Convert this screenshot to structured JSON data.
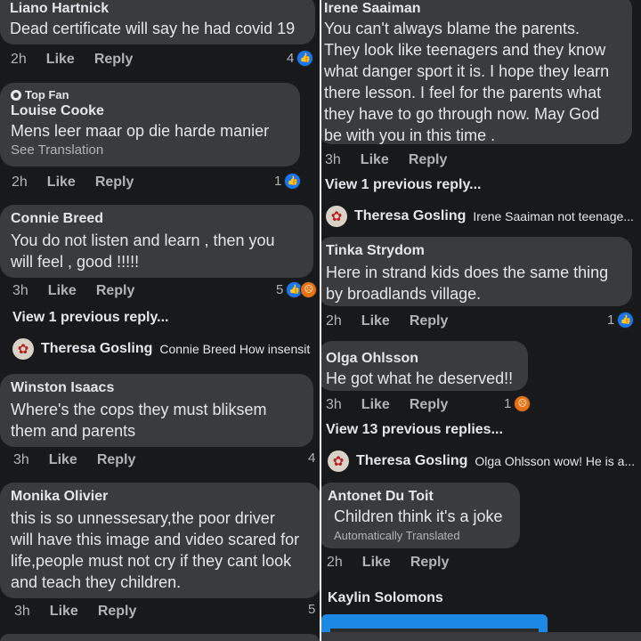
{
  "actions": {
    "like": "Like",
    "reply": "Reply"
  },
  "left": {
    "c1": {
      "name": "Liano Hartnick",
      "text": "Dead certificate will say he had covid 19",
      "time": "2h",
      "count": "4"
    },
    "c2": {
      "badge": "Top Fan",
      "name": "Louise Cooke",
      "text": "Mens leer maar op die harde manier",
      "translate": "See Translation",
      "time": "2h",
      "count": "1"
    },
    "c3": {
      "name": "Connie Breed",
      "text1": "You do not listen and learn , then you",
      "text2": "will feel , good !!!!!",
      "time": "3h",
      "count": "5",
      "view_more": "View 1 previous reply...",
      "reply": {
        "name": "Theresa Gosling",
        "text": "Connie Breed How insensit"
      }
    },
    "c4": {
      "name": "Winston Isaacs",
      "text1": "Where's the cops they must bliksem",
      "text2": "them and parents",
      "time": "3h",
      "count": "4"
    },
    "c5": {
      "name": "Monika Olivier",
      "text1": "this is so unnessesary,the poor driver",
      "text2": "will have this image and video scared for",
      "text3": "life,people must not cry if they cant look",
      "text4": "and teach they children.",
      "time": "3h",
      "count": "5"
    }
  },
  "right": {
    "c1": {
      "name": "Irene Saaiman",
      "text1": "You can't always blame the parents.",
      "text2": "They look like teenagers and they know",
      "text3": "what danger sport it is. I hope they learn",
      "text4": "there lesson. I feel for the parents what",
      "text5": "they have to go through now. May God",
      "text6": "be with you in this time .",
      "time": "3h",
      "view_more": "View 1 previous reply...",
      "reply": {
        "name": "Theresa Gosling",
        "text": "Irene Saaiman not teenage..."
      }
    },
    "c2": {
      "name": "Tinka Strydom",
      "text1": "Here in strand kids does the same thing",
      "text2": "by broadlands village.",
      "time": "2h",
      "count": "1"
    },
    "c3": {
      "name": "Olga Ohlsson",
      "text": "He got what he deserved!!",
      "time": "3h",
      "count": "1",
      "view_more": "View 13 previous replies...",
      "reply": {
        "name": "Theresa Gosling",
        "text": "Olga Ohlsson wow! He is a..."
      }
    },
    "c4": {
      "name": "Antonet Du Toit",
      "text": "Children think it's a joke",
      "translate": "Automatically Translated",
      "time": "2h"
    },
    "c5": {
      "name": "Kaylin Solomons"
    }
  }
}
